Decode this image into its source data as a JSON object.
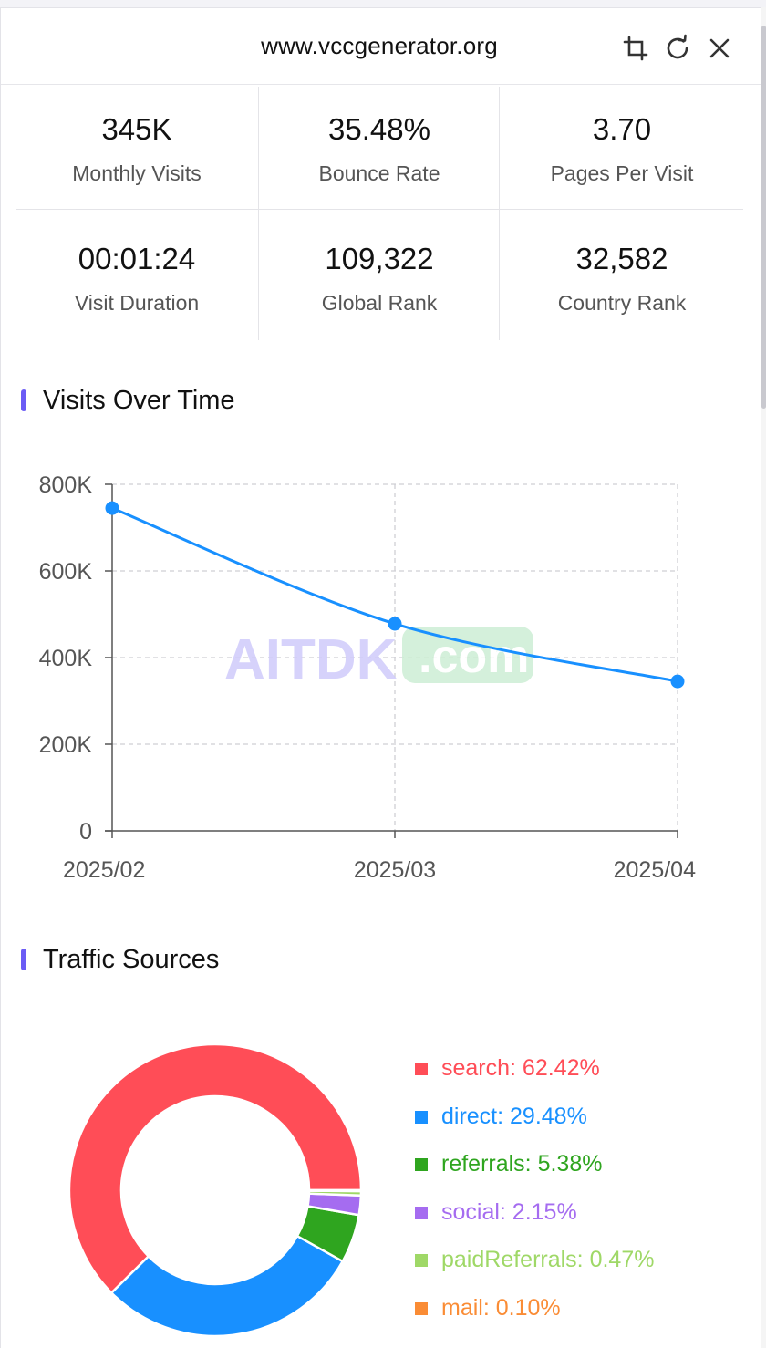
{
  "header": {
    "title": "www.vccgenerator.org"
  },
  "stats": [
    {
      "value": "345K",
      "label": "Monthly Visits"
    },
    {
      "value": "35.48%",
      "label": "Bounce Rate"
    },
    {
      "value": "3.70",
      "label": "Pages Per Visit"
    },
    {
      "value": "00:01:24",
      "label": "Visit Duration"
    },
    {
      "value": "109,322",
      "label": "Global Rank"
    },
    {
      "value": "32,582",
      "label": "Country Rank"
    }
  ],
  "sections": {
    "visits_title": "Visits Over Time",
    "traffic_title": "Traffic Sources"
  },
  "watermark": {
    "main": "AITDK",
    "suffix": ".com"
  },
  "colors": {
    "accent": "#6b5cf5",
    "line": "#1890ff",
    "search": "#ff4d57",
    "direct": "#1890ff",
    "referrals": "#2fa51f",
    "social": "#a56cf0",
    "paidReferrals": "#9fd867",
    "mail": "#fa8c35"
  },
  "chart_data": [
    {
      "type": "line",
      "title": "Visits Over Time",
      "x": [
        "2025/02",
        "2025/03",
        "2025/04"
      ],
      "y_ticks": [
        "0",
        "200K",
        "400K",
        "600K",
        "800K"
      ],
      "ylim": [
        0,
        800000
      ],
      "series": [
        {
          "values": [
            745000,
            478000,
            345000
          ]
        }
      ],
      "grid": true
    },
    {
      "type": "pie",
      "title": "Traffic Sources",
      "donut": true,
      "legend_position": "right",
      "slices": [
        {
          "key": "search",
          "label": "search: 62.42%",
          "value": 62.42
        },
        {
          "key": "direct",
          "label": "direct: 29.48%",
          "value": 29.48
        },
        {
          "key": "referrals",
          "label": "referrals: 5.38%",
          "value": 5.38
        },
        {
          "key": "social",
          "label": "social: 2.15%",
          "value": 2.15
        },
        {
          "key": "paidReferrals",
          "label": "paidReferrals: 0.47%",
          "value": 0.47
        },
        {
          "key": "mail",
          "label": "mail: 0.10%",
          "value": 0.1
        }
      ]
    }
  ]
}
